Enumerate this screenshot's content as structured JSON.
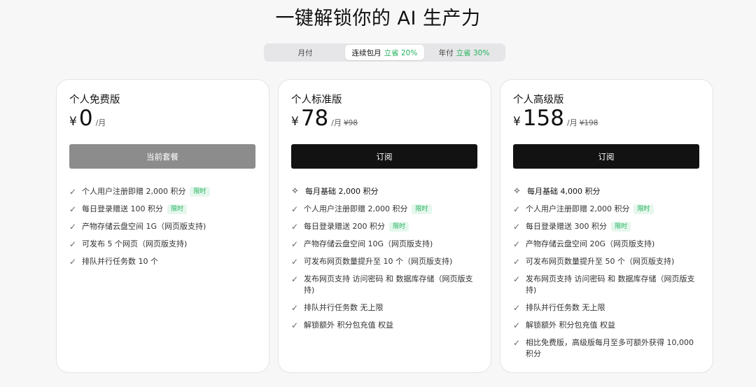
{
  "header": {
    "title": "一键解锁你的 AI 生产力"
  },
  "billing": {
    "monthly": "月付",
    "continuous": "连续包月",
    "continuous_discount": "立省 20%",
    "yearly": "年付",
    "yearly_discount": "立省 30%",
    "selected": "连续包月"
  },
  "plans": [
    {
      "name": "个人免费版",
      "currency": "¥",
      "price": "0",
      "per": "/月",
      "original": "",
      "button": "当前套餐",
      "features": [
        {
          "text": "个人用户注册即赠 2,000 积分",
          "badge": "限时"
        },
        {
          "text": "每日登录赠送 100 积分",
          "badge": "限时"
        },
        {
          "text": "产物存储云盘空间 1G（网页版支持)"
        },
        {
          "text": "可发布 5 个网页（网页版支持)"
        },
        {
          "text": "排队并行任务数 10 个"
        }
      ]
    },
    {
      "name": "个人标准版",
      "currency": "¥",
      "price": "78",
      "per": "/月",
      "original": "¥98",
      "button": "订阅",
      "highlight": "每月基础 2,000 积分",
      "features": [
        {
          "text": "个人用户注册即赠 2,000 积分",
          "badge": "限时"
        },
        {
          "text": "每日登录赠送 200 积分",
          "badge": "限时"
        },
        {
          "text": "产物存储云盘空间 10G（网页版支持)"
        },
        {
          "text": "可发布网页数量提升至 10 个（网页版支持)"
        },
        {
          "text": "发布网页支持 访问密码 和 数据库存储（网页版支持)"
        },
        {
          "text": "排队并行任务数 无上限"
        },
        {
          "text": "解锁额外 积分包充值 权益"
        }
      ]
    },
    {
      "name": "个人高级版",
      "currency": "¥",
      "price": "158",
      "per": "/月",
      "original": "¥198",
      "button": "订阅",
      "highlight": "每月基础 4,000 积分",
      "features": [
        {
          "text": "个人用户注册即赠 2,000 积分",
          "badge": "限时"
        },
        {
          "text": "每日登录赠送 300 积分",
          "badge": "限时"
        },
        {
          "text": "产物存储云盘空间 20G（网页版支持)"
        },
        {
          "text": "可发布网页数量提升至 50 个（网页版支持)"
        },
        {
          "text": "发布网页支持 访问密码 和 数据库存储（网页版支持)"
        },
        {
          "text": "排队并行任务数 无上限"
        },
        {
          "text": "解锁额外 积分包充值 权益"
        },
        {
          "text": "相比免费版，高级版每月至多可额外获得 10,000 积分"
        }
      ]
    }
  ],
  "icons": {
    "check": "check-icon",
    "sparkle": "sparkle-icon"
  },
  "colors": {
    "accent_green": "#22b35e",
    "button_dark": "#121212",
    "button_current": "#8c8c8c"
  }
}
